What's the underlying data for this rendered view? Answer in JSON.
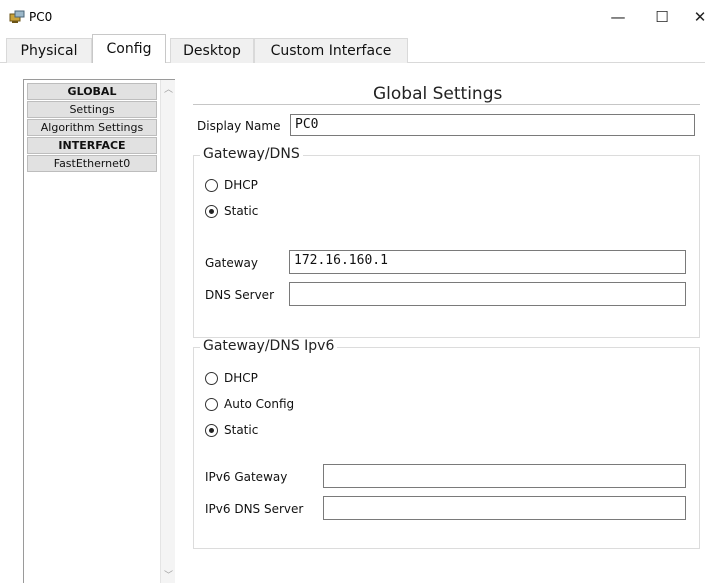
{
  "window": {
    "title": "PC0",
    "minimize_glyph": "—",
    "maximize_glyph": "☐",
    "close_glyph": "✕"
  },
  "tabs": [
    {
      "label": "Physical",
      "active": false
    },
    {
      "label": "Config",
      "active": true
    },
    {
      "label": "Desktop",
      "active": false
    },
    {
      "label": "Custom Interface",
      "active": false
    }
  ],
  "sidebar": {
    "items": [
      {
        "label": "GLOBAL",
        "header": true
      },
      {
        "label": "Settings",
        "header": false
      },
      {
        "label": "Algorithm Settings",
        "header": false
      },
      {
        "label": "INTERFACE",
        "header": true
      },
      {
        "label": "FastEthernet0",
        "header": false
      }
    ]
  },
  "main": {
    "title": "Global Settings",
    "display_name_label": "Display Name",
    "display_name_value": "PC0",
    "gateway_dns": {
      "title": "Gateway/DNS",
      "dhcp_label": "DHCP",
      "static_label": "Static",
      "selected": "Static",
      "gateway_label": "Gateway",
      "gateway_value": "172.16.160.1",
      "dns_label": "DNS Server",
      "dns_value": ""
    },
    "gateway_dns_ipv6": {
      "title": "Gateway/DNS Ipv6",
      "dhcp_label": "DHCP",
      "auto_label": "Auto Config",
      "static_label": "Static",
      "selected": "Static",
      "gateway_label": "IPv6 Gateway",
      "gateway_value": "",
      "dns_label": "IPv6 DNS Server",
      "dns_value": ""
    }
  }
}
